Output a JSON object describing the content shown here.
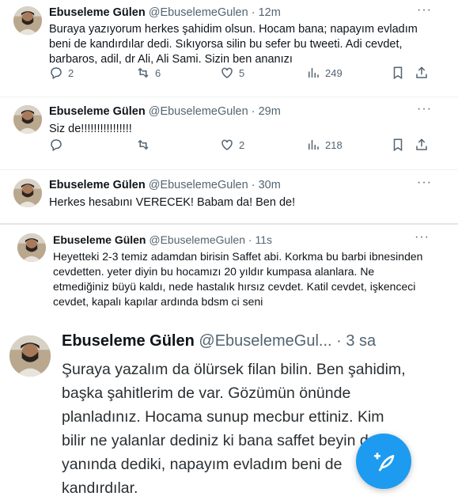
{
  "tweets": [
    {
      "name": "Ebuseleme Gülen",
      "handle": "@EbuselemeGulen",
      "time": "· 12m",
      "text": "Buraya yazıyorum herkes şahidim olsun. Hocam bana; napayım evladım beni de kandırdılar dedi. Sıkıyorsa silin bu sefer bu tweeti. Adi cevdet, barbaros, adil, dr Ali, Ali Sami. Sizin ben ananızı",
      "replies": "2",
      "retweets": "6",
      "likes": "5",
      "views": "249"
    },
    {
      "name": "Ebuseleme Gülen",
      "handle": "@EbuselemeGulen",
      "time": "· 29m",
      "text": "Siz de!!!!!!!!!!!!!!!!",
      "replies": "",
      "retweets": "",
      "likes": "2",
      "views": "218"
    },
    {
      "name": "Ebuseleme Gülen",
      "handle": "@EbuselemeGulen",
      "time": "· 30m",
      "text": "Herkes hesabını VERECEK! Babam da! Ben de!"
    },
    {
      "name": "Ebuseleme Gülen",
      "handle": "@EbuselemeGulen",
      "time": "· 11s",
      "text": "Heyetteki 2-3 temiz adamdan birisin Saffet abi. Korkma bu barbi ibnesinden cevdetten. yeter diyin bu hocamızı 20 yıldır kumpasa alanlara. Ne etmediğiniz büyü kaldı, nede hastalık hırsız cevdet. Katil cevdet, işkenceci cevdet, kapalı kapılar ardında bdsm ci seni"
    },
    {
      "name": "Ebuseleme Gülen",
      "handle": "@EbuselemeGul...",
      "time": "· 3 sa",
      "text": "Şuraya yazalım da ölürsek filan bilin. Ben şahidim, başka şahitlerim de var. Gözümün önünde planladınız. Hocama sunup mecbur ettiniz. Kim bilir ne yalanlar dediniz ki bana saffet beyin de yanında dediki, napayım evladım beni de kandırdılar."
    }
  ],
  "icons": [
    "more-icon",
    "reply-icon",
    "retweet-icon",
    "like-icon",
    "views-icon",
    "bookmark-icon",
    "share-icon",
    "compose-icon"
  ],
  "colors": {
    "accent": "#1d9bf0",
    "text": "#0f1419",
    "muted": "#536471"
  }
}
